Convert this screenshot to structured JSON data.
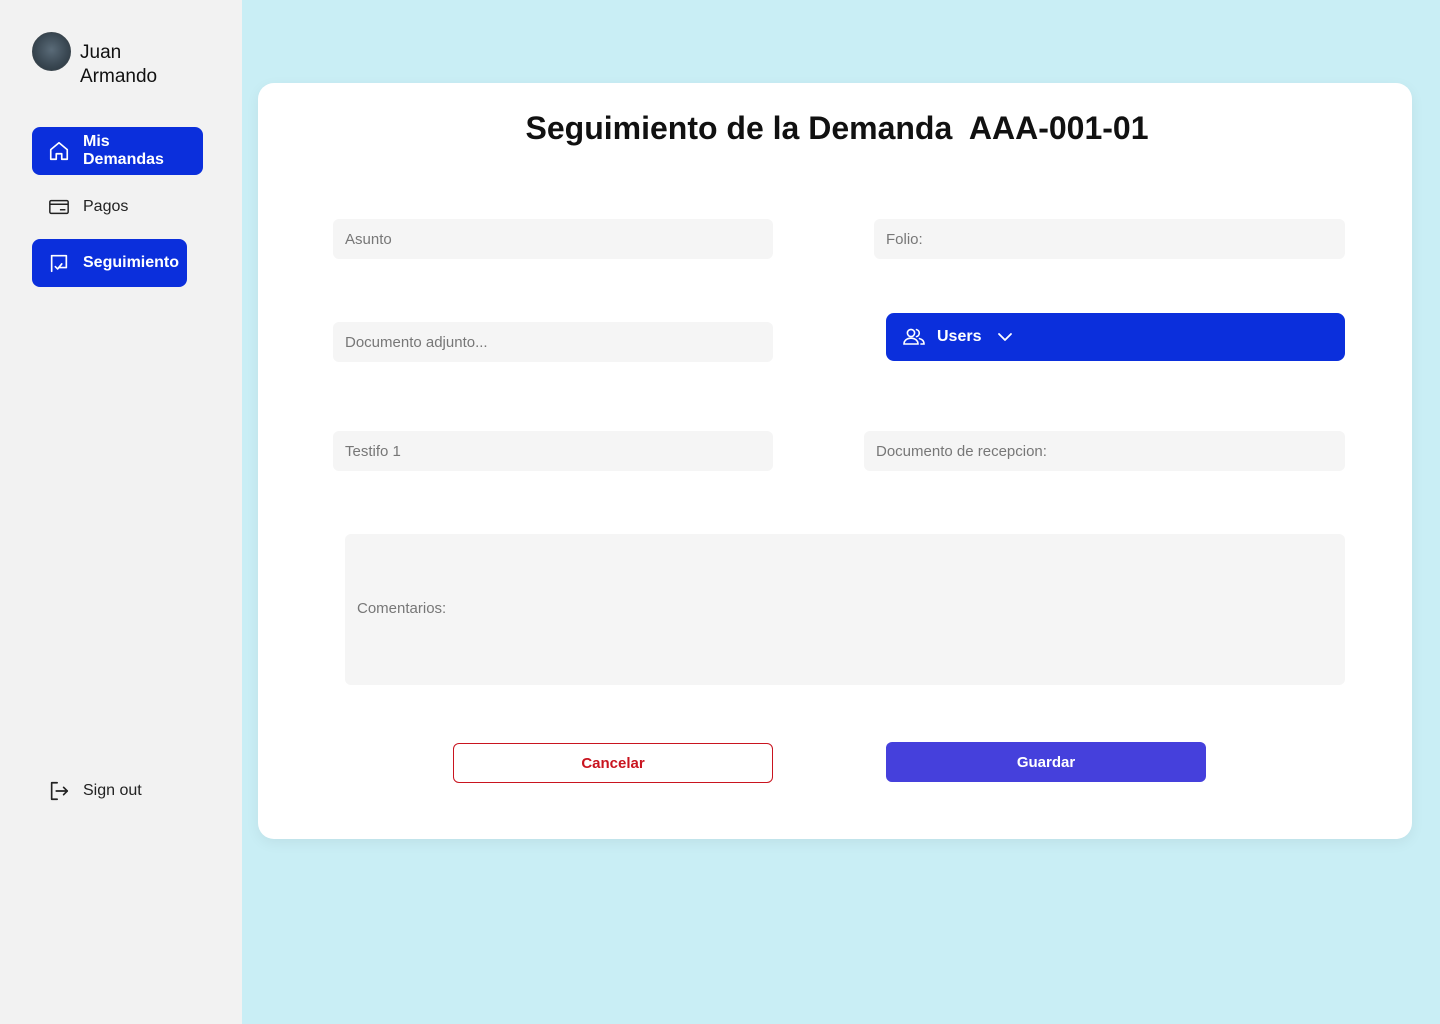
{
  "sidebar": {
    "user": {
      "name": "Juan Armando"
    },
    "items": [
      {
        "label": "Mis Demandas",
        "icon": "home-icon",
        "active": true
      },
      {
        "label": "Pagos",
        "icon": "credit-card-icon",
        "active": false
      },
      {
        "label": "Seguimiento",
        "icon": "tracking-check-icon",
        "active": true
      }
    ],
    "signout": {
      "label": "Sign out",
      "icon": "logout-icon"
    }
  },
  "main": {
    "title": "Seguimiento de la Demanda  AAA-001-01",
    "fields": {
      "asunto": {
        "placeholder": "Asunto",
        "value": ""
      },
      "folio": {
        "placeholder": "Folio:",
        "value": ""
      },
      "documento_adjunto": {
        "placeholder": "Documento adjunto...",
        "value": ""
      },
      "testifo": {
        "placeholder": "Testifo 1",
        "value": ""
      },
      "documento_recepcion": {
        "placeholder": "Documento de recepcion:",
        "value": ""
      },
      "comentarios": {
        "placeholder": "Comentarios:",
        "value": ""
      }
    },
    "users_select": {
      "label": "Users",
      "icon": "users-icon",
      "chevron": "chevron-down-icon"
    },
    "buttons": {
      "cancel": "Cancelar",
      "save": "Guardar"
    }
  },
  "colors": {
    "background": "#c9eef5",
    "sidebar": "#f2f2f2",
    "primary": "#0b2fdc",
    "save": "#4540dc",
    "cancel": "#c9141f",
    "field": "#f5f5f5"
  }
}
